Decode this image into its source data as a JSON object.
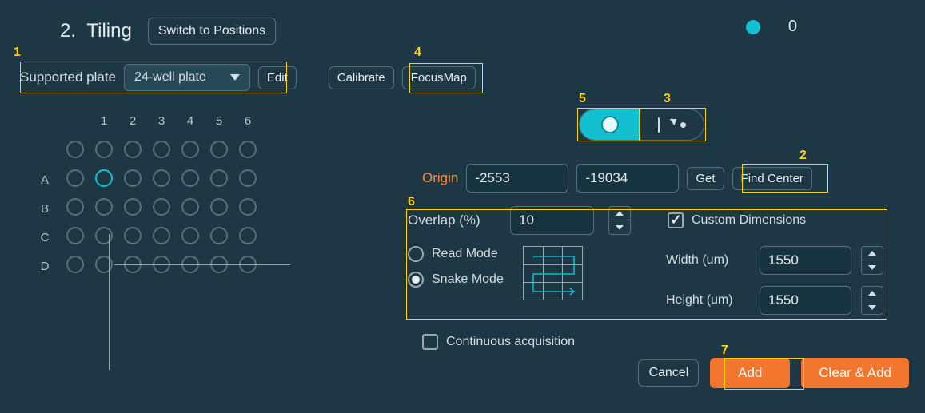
{
  "annotations": {
    "n1": "1",
    "n2": "2",
    "n3": "3",
    "n4": "4",
    "n5": "5",
    "n6": "6",
    "n7": "7"
  },
  "header": {
    "step": "2.",
    "title": "Tiling",
    "switch_label": "Switch to Positions"
  },
  "counter": {
    "value": "0"
  },
  "plate_row": {
    "label": "Supported plate",
    "selected": "24-well plate",
    "edit": "Edit",
    "calibrate": "Calibrate",
    "focusmap": "FocusMap"
  },
  "plate": {
    "cols": [
      "1",
      "2",
      "3",
      "4",
      "5",
      "6"
    ],
    "rows": [
      "A",
      "B",
      "C",
      "D"
    ]
  },
  "origin": {
    "label": "Origin",
    "x": "-2553",
    "y": "-19034",
    "get": "Get",
    "find_center": "Find Center"
  },
  "overlap": {
    "label": "Overlap (%)",
    "value": "10"
  },
  "mode": {
    "read": "Read Mode",
    "snake": "Snake Mode"
  },
  "dims": {
    "custom": "Custom Dimensions",
    "width_label": "Width (um)",
    "width": "1550",
    "height_label": "Height (um)",
    "height": "1550"
  },
  "cont_acq": "Continuous acquisition",
  "buttons": {
    "cancel": "Cancel",
    "add": "Add",
    "clear_add": "Clear & Add"
  }
}
